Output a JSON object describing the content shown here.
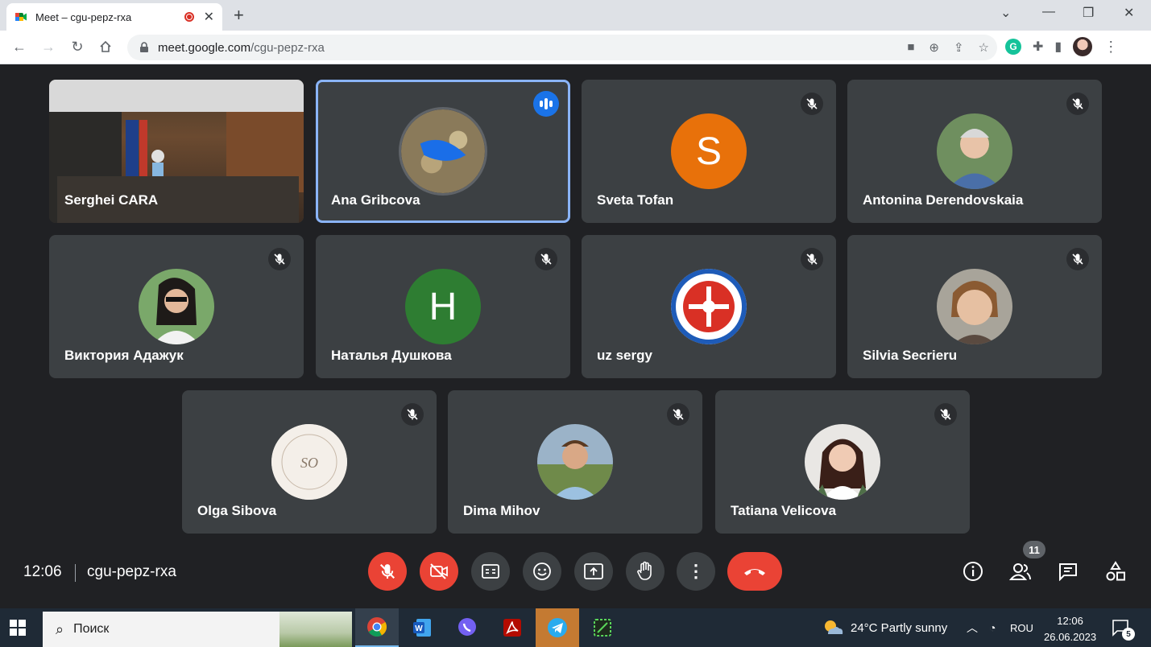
{
  "browser": {
    "tab_title": "Meet – cgu-pepz-rxa",
    "url_host": "meet.google.com",
    "url_path": "/cgu-pepz-rxa"
  },
  "participants": [
    {
      "name": "Serghei CARA",
      "type": "video",
      "muted": false
    },
    {
      "name": "Ana Gribcova",
      "type": "image",
      "speaking": true
    },
    {
      "name": "Sveta Tofan",
      "type": "letter",
      "letter": "S",
      "color": "#e8710a",
      "muted": true
    },
    {
      "name": "Antonina Derendovskaia",
      "type": "photo",
      "muted": true
    },
    {
      "name": "Виктория Адажук",
      "type": "photo",
      "muted": true
    },
    {
      "name": "Наталья Душкова",
      "type": "letter",
      "letter": "H",
      "color": "#2e7d32",
      "muted": true
    },
    {
      "name": "uz sergy",
      "type": "logo",
      "muted": true
    },
    {
      "name": "Silvia Secrieru",
      "type": "photo",
      "muted": true
    },
    {
      "name": "Olga Sibova",
      "type": "logo",
      "logo_text": "SO",
      "muted": true
    },
    {
      "name": "Dima Mihov",
      "type": "photo",
      "muted": true
    },
    {
      "name": "Tatiana Velicova",
      "type": "photo",
      "muted": true
    }
  ],
  "meeting": {
    "time": "12:06",
    "code": "cgu-pepz-rxa",
    "participant_count": "11"
  },
  "taskbar": {
    "search_placeholder": "Поиск",
    "weather": "24°C  Partly sunny",
    "language": "ROU",
    "clock_time": "12:06",
    "clock_date": "26.06.2023",
    "notifications": "5"
  }
}
